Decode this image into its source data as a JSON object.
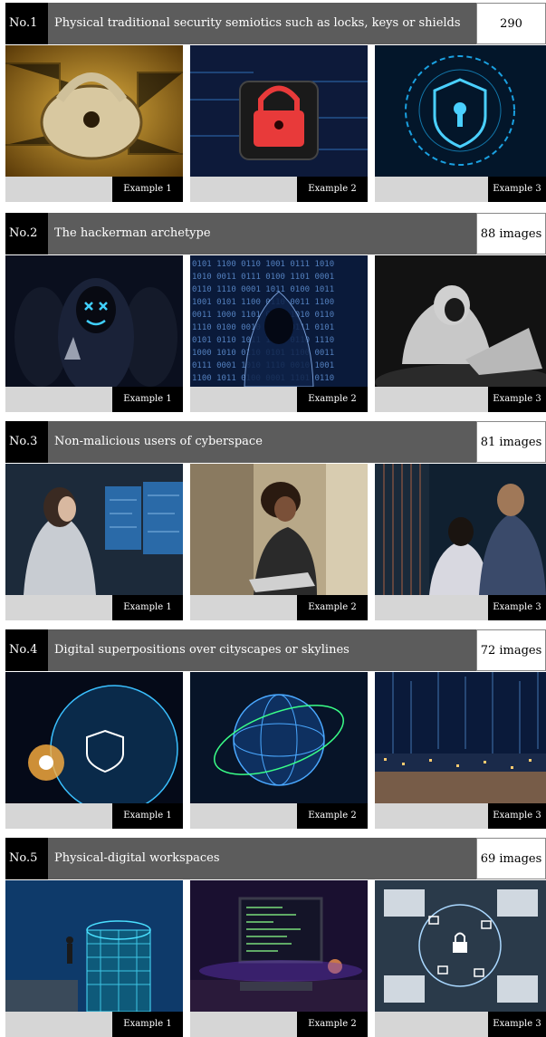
{
  "sections": [
    {
      "number": "No.1",
      "title": "Physical traditional security semiotics such as locks, keys or shields",
      "count": "290 images",
      "examples": [
        "Example 1",
        "Example 2",
        "Example 3"
      ]
    },
    {
      "number": "No.2",
      "title": "The hackerman archetype",
      "count": "88 images",
      "examples": [
        "Example 1",
        "Example 2",
        "Example 3"
      ]
    },
    {
      "number": "No.3",
      "title": "Non-malicious users of cyberspace",
      "count": "81 images",
      "examples": [
        "Example 1",
        "Example 2",
        "Example 3"
      ]
    },
    {
      "number": "No.4",
      "title": "Digital superpositions over cityscapes or skylines",
      "count": "72 images",
      "examples": [
        "Example 1",
        "Example 2",
        "Example 3"
      ]
    },
    {
      "number": "No.5",
      "title": "Physical-digital workspaces",
      "count": "69 images",
      "examples": [
        "Example 1",
        "Example 2",
        "Example 3"
      ]
    }
  ],
  "image_subjects": [
    [
      "ornate-padlock-on-circuit-board",
      "red-padlock-on-chip",
      "glowing-shield-keyhole"
    ],
    [
      "hooded-figures-led-mask",
      "hooded-figure-binary-code",
      "hooded-person-at-laptop"
    ],
    [
      "woman-at-monitors",
      "person-with-laptop-outdoors",
      "two-people-at-server-rack"
    ],
    [
      "glowing-globe-shield",
      "wireframe-globe",
      "night-city-skyline-lights"
    ],
    [
      "man-on-digital-tower",
      "desk-with-code-monitor",
      "hands-on-laptops-with-lock-icons"
    ]
  ]
}
